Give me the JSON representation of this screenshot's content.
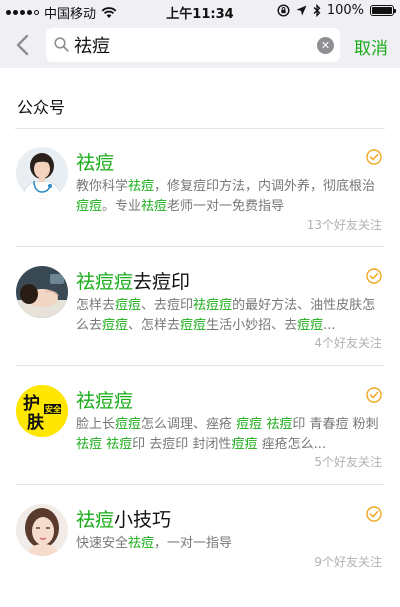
{
  "status": {
    "carrier": "中国移动",
    "time": "上午11:34",
    "battery": "100%",
    "signal_bars": 4,
    "battery_level": 1.0
  },
  "search": {
    "query": "祛痘",
    "cancel_label": "取消",
    "accent": "#1aad19"
  },
  "section": {
    "title": "公众号"
  },
  "results": [
    {
      "name_hl": "祛痘",
      "name_rest": "",
      "desc": [
        {
          "t": "教你科学"
        },
        {
          "t": "祛痘",
          "h": true
        },
        {
          "t": "，修复痘印方法，内调外养，彻底根治"
        },
        {
          "t": "痘痘",
          "h": true
        },
        {
          "t": "。专业"
        },
        {
          "t": "祛痘",
          "h": true
        },
        {
          "t": "老师一对一免费指导"
        }
      ],
      "friends": "13个好友关注",
      "avatar": "doctor-avatar"
    },
    {
      "name_hl": "祛痘痘",
      "name_rest": "去痘印",
      "desc": [
        {
          "t": "怎样去"
        },
        {
          "t": "痘痘",
          "h": true
        },
        {
          "t": "、去痘印"
        },
        {
          "t": "祛痘痘",
          "h": true
        },
        {
          "t": "的最好方法、油性皮肤怎么去"
        },
        {
          "t": "痘痘",
          "h": true
        },
        {
          "t": "、怎样去"
        },
        {
          "t": "痘痘",
          "h": true
        },
        {
          "t": "生活小妙招、去"
        },
        {
          "t": "痘痘",
          "h": true
        },
        {
          "t": "..."
        }
      ],
      "friends": "4个好友关注",
      "avatar": "spa-avatar"
    },
    {
      "name_hl": "祛痘痘",
      "name_rest": "",
      "desc": [
        {
          "t": "脸上长"
        },
        {
          "t": "痘痘",
          "h": true
        },
        {
          "t": "怎么调理、痤疮 "
        },
        {
          "t": "痘痘",
          "h": true
        },
        {
          "t": " "
        },
        {
          "t": "祛痘",
          "h": true
        },
        {
          "t": "印 青春痘 粉刺 "
        },
        {
          "t": "祛痘",
          "h": true
        },
        {
          "t": " "
        },
        {
          "t": "祛痘",
          "h": true
        },
        {
          "t": "印 去痘印 封闭性"
        },
        {
          "t": "痘痘",
          "h": true
        },
        {
          "t": " 痤疮怎么..."
        }
      ],
      "friends": "5个好友关注",
      "avatar": "skincare-logo-avatar",
      "logo_text": [
        "护",
        "安全",
        "肤"
      ]
    },
    {
      "name_hl": "祛痘",
      "name_rest": "小技巧",
      "desc": [
        {
          "t": "快速安全"
        },
        {
          "t": "祛痘",
          "h": true
        },
        {
          "t": "，一对一指导"
        }
      ],
      "friends": "9个好友关注",
      "avatar": "woman-avatar"
    }
  ]
}
